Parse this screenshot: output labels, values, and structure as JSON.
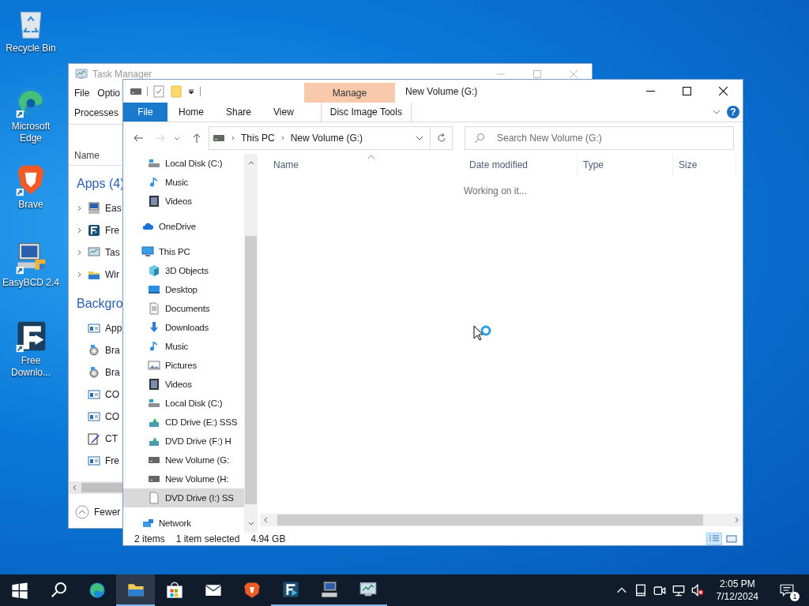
{
  "desktop_icons": [
    {
      "label": "Recycle Bin",
      "kind": "recycle"
    },
    {
      "label": "Microsoft Edge",
      "kind": "edge"
    },
    {
      "label": "Brave",
      "kind": "brave"
    },
    {
      "label": "EasyBCD 2.4",
      "kind": "easybcd"
    },
    {
      "label": "Free Downlo...",
      "kind": "fdm"
    }
  ],
  "task_manager": {
    "title": "Task Manager",
    "menu": [
      "File",
      "Optio"
    ],
    "tab": "Processes",
    "column": "Name",
    "groups": [
      {
        "title": "Apps (4)",
        "rows": [
          {
            "label": "Eas",
            "kind": "computer",
            "expanded": false
          },
          {
            "label": "Fre",
            "kind": "fdm",
            "expanded": false
          },
          {
            "label": "Tas",
            "kind": "monitor",
            "expanded": false
          },
          {
            "label": "Wir",
            "kind": "folder",
            "expanded": false
          }
        ]
      },
      {
        "title": "Backgro",
        "rows": [
          {
            "label": "App",
            "kind": "window"
          },
          {
            "label": "Bra",
            "kind": "gear"
          },
          {
            "label": "Bra",
            "kind": "gear"
          },
          {
            "label": "CO",
            "kind": "window"
          },
          {
            "label": "CO",
            "kind": "window"
          },
          {
            "label": "CT",
            "kind": "pen"
          },
          {
            "label": "Fre",
            "kind": "window"
          }
        ]
      }
    ],
    "footer": "Fewer"
  },
  "explorer": {
    "title": "New Volume (G:)",
    "context_header": "Manage",
    "context_tab": "Disc Image Tools",
    "ribbon_tabs": [
      {
        "label": "File",
        "kind": "file"
      },
      {
        "label": "Home",
        "kind": "tab"
      },
      {
        "label": "Share",
        "kind": "tab"
      },
      {
        "label": "View",
        "kind": "tab"
      }
    ],
    "help": "?",
    "breadcrumb": [
      "This PC",
      "New Volume (G:)"
    ],
    "search": {
      "placeholder": "Search New Volume (G:)"
    },
    "nav_tree": [
      {
        "children": [
          {
            "label": "Local Disk (C:)",
            "kind": "drive",
            "selected": false
          },
          {
            "label": "Music",
            "kind": "music",
            "selected": false
          },
          {
            "label": "Videos",
            "kind": "video",
            "selected": false
          }
        ]
      },
      {
        "label": "OneDrive",
        "kind": "cloud",
        "selected": false
      },
      {
        "label": "This PC",
        "kind": "pc",
        "selected": false,
        "children": [
          {
            "label": "3D Objects",
            "kind": "objects",
            "selected": false
          },
          {
            "label": "Desktop",
            "kind": "desktop",
            "selected": false
          },
          {
            "label": "Documents",
            "kind": "documents",
            "selected": false
          },
          {
            "label": "Downloads",
            "kind": "downloads",
            "selected": false
          },
          {
            "label": "Music",
            "kind": "music",
            "selected": false
          },
          {
            "label": "Pictures",
            "kind": "pictures",
            "selected": false
          },
          {
            "label": "Videos",
            "kind": "video",
            "selected": false
          },
          {
            "label": "Local Disk (C:)",
            "kind": "drive",
            "selected": false
          },
          {
            "label": "CD Drive (E:) SSS",
            "kind": "optical",
            "selected": false
          },
          {
            "label": "DVD Drive (F:) H",
            "kind": "optical",
            "selected": false
          },
          {
            "label": "New Volume (G:",
            "kind": "volume",
            "selected": false
          },
          {
            "label": "New Volume (H:",
            "kind": "volume",
            "selected": false
          },
          {
            "label": "DVD Drive (I:) SS",
            "kind": "file",
            "selected": true
          }
        ]
      },
      {
        "label": "Network",
        "kind": "network",
        "selected": false
      }
    ],
    "columns": [
      {
        "label": "Name",
        "sorted": true
      },
      {
        "label": "Date modified",
        "sorted": false
      },
      {
        "label": "Type",
        "sorted": false
      },
      {
        "label": "Size",
        "sorted": false
      }
    ],
    "message": "Working on it...",
    "status": {
      "items": "2 items",
      "selected": "1 item selected",
      "size": "4.94 GB"
    },
    "view_buttons": [
      {
        "kind": "details",
        "selected": true
      },
      {
        "kind": "large_icons",
        "selected": false
      }
    ]
  },
  "taskbar": {
    "buttons": [
      {
        "kind": "start",
        "running": false,
        "active": false
      },
      {
        "kind": "search",
        "running": false,
        "active": false
      },
      {
        "kind": "edge",
        "running": false,
        "active": false
      },
      {
        "kind": "folder",
        "running": true,
        "active": true
      },
      {
        "kind": "store",
        "running": false,
        "active": false
      },
      {
        "kind": "mail",
        "running": false,
        "active": false
      },
      {
        "kind": "brave",
        "running": false,
        "active": false
      },
      {
        "kind": "fdm",
        "running": true,
        "active": false
      },
      {
        "kind": "easybcd",
        "running": true,
        "active": false
      },
      {
        "kind": "taskmgr",
        "running": true,
        "active": false
      }
    ],
    "time": "2:05 PM",
    "date": "7/12/2024",
    "notifications": "1"
  }
}
